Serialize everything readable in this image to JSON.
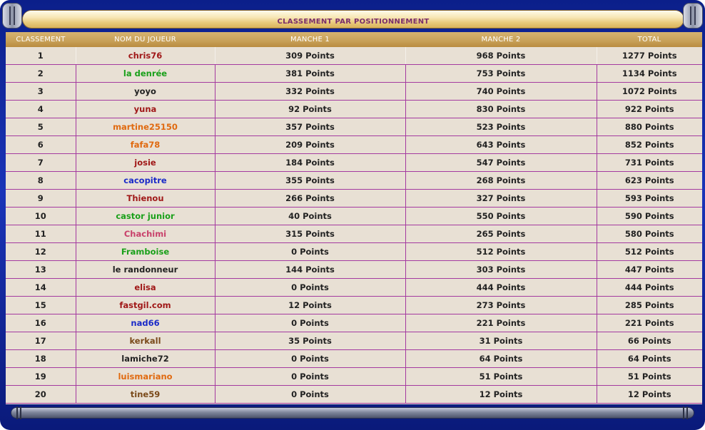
{
  "title": "CLASSEMENT PAR POSITIONNEMENT",
  "columns": [
    "CLASSEMENT",
    "NOM DU JOUEUR",
    "MANCHE 1",
    "MANCHE 2",
    "TOTAL"
  ],
  "rows": [
    {
      "rank": "1",
      "name": "chris76",
      "color": "#a01818",
      "m1": "309 Points",
      "m2": "968 Points",
      "total": "1277 Points"
    },
    {
      "rank": "2",
      "name": "la denrée",
      "color": "#1aa01a",
      "m1": "381 Points",
      "m2": "753 Points",
      "total": "1134 Points"
    },
    {
      "rank": "3",
      "name": "yoyo",
      "color": "#222222",
      "m1": "332 Points",
      "m2": "740 Points",
      "total": "1072 Points"
    },
    {
      "rank": "4",
      "name": "yuna",
      "color": "#a01818",
      "m1": "92 Points",
      "m2": "830 Points",
      "total": "922 Points"
    },
    {
      "rank": "5",
      "name": "martine25150",
      "color": "#e06a10",
      "m1": "357 Points",
      "m2": "523 Points",
      "total": "880 Points"
    },
    {
      "rank": "6",
      "name": "fafa78",
      "color": "#e06a10",
      "m1": "209 Points",
      "m2": "643 Points",
      "total": "852 Points"
    },
    {
      "rank": "7",
      "name": "josie",
      "color": "#a01818",
      "m1": "184 Points",
      "m2": "547 Points",
      "total": "731 Points"
    },
    {
      "rank": "8",
      "name": "cacopitre",
      "color": "#1a2ac8",
      "m1": "355 Points",
      "m2": "268 Points",
      "total": "623 Points"
    },
    {
      "rank": "9",
      "name": "Thienou",
      "color": "#a01818",
      "m1": "266 Points",
      "m2": "327 Points",
      "total": "593 Points"
    },
    {
      "rank": "10",
      "name": "castor junior",
      "color": "#1aa01a",
      "m1": "40 Points",
      "m2": "550 Points",
      "total": "590 Points"
    },
    {
      "rank": "11",
      "name": "Chachimi",
      "color": "#c8406a",
      "m1": "315 Points",
      "m2": "265 Points",
      "total": "580 Points"
    },
    {
      "rank": "12",
      "name": "Framboise",
      "color": "#1aa01a",
      "m1": "0 Points",
      "m2": "512 Points",
      "total": "512 Points"
    },
    {
      "rank": "13",
      "name": "le randonneur",
      "color": "#222222",
      "m1": "144 Points",
      "m2": "303 Points",
      "total": "447 Points"
    },
    {
      "rank": "14",
      "name": "elisa",
      "color": "#a01818",
      "m1": "0 Points",
      "m2": "444 Points",
      "total": "444 Points"
    },
    {
      "rank": "15",
      "name": "fastgil.com",
      "color": "#a01818",
      "m1": "12 Points",
      "m2": "273 Points",
      "total": "285 Points"
    },
    {
      "rank": "16",
      "name": "nad66",
      "color": "#1a2ac8",
      "m1": "0 Points",
      "m2": "221 Points",
      "total": "221 Points"
    },
    {
      "rank": "17",
      "name": "kerkall",
      "color": "#7a4a1a",
      "m1": "35 Points",
      "m2": "31 Points",
      "total": "66 Points"
    },
    {
      "rank": "18",
      "name": "lamiche72",
      "color": "#222222",
      "m1": "0 Points",
      "m2": "64 Points",
      "total": "64 Points"
    },
    {
      "rank": "19",
      "name": "luismariano",
      "color": "#e06a10",
      "m1": "0 Points",
      "m2": "51 Points",
      "total": "51 Points"
    },
    {
      "rank": "20",
      "name": "tine59",
      "color": "#7a4a1a",
      "m1": "0 Points",
      "m2": "12 Points",
      "total": "12 Points"
    }
  ]
}
